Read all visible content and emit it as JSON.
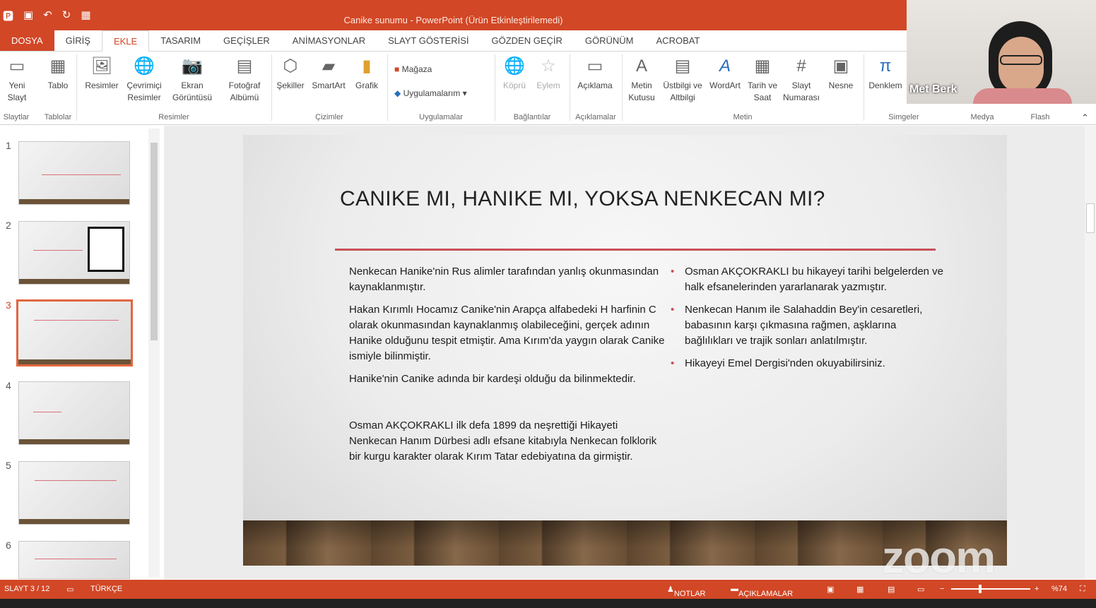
{
  "window": {
    "title": "Canike sunumu  -  PowerPoint (Ürün Etkinleştirilemedi)"
  },
  "tabs": [
    "DOSYA",
    "GİRİŞ",
    "EKLE",
    "TASARIM",
    "GEÇİŞLER",
    "ANİMASYONLAR",
    "SLAYT GÖSTERİSİ",
    "GÖZDEN GEÇİR",
    "GÖRÜNÜM",
    "ACROBAT"
  ],
  "ribbon": {
    "yeni_slayt": "Yeni Slayt",
    "tablo": "Tablo",
    "resimler": "Resimler",
    "cevrimici_resimler": "Çevrimiçi Resimler",
    "ekran_goruntusu": "Ekran Görüntüsü",
    "fotograf_albumu": "Fotoğraf Albümü",
    "sekiller": "Şekiller",
    "smartart": "SmartArt",
    "grafik": "Grafik",
    "magaza": "Mağaza",
    "uygulamalarim": "Uygulamalarım",
    "kopru": "Köprü",
    "eylem": "Eylem",
    "aciklama": "Açıklama",
    "metin_kutusu": "Metin Kutusu",
    "ustbilgi": "Üstbilgi ve Altbilgi",
    "wordart": "WordArt",
    "tarih_saat": "Tarih ve Saat",
    "slayt_numarasi": "Slayt Numarası",
    "nesne": "Nesne",
    "denklem": "Denklem",
    "groups": {
      "slaytlar": "Slaytlar",
      "tablolar": "Tablolar",
      "resimler": "Resimler",
      "cizimler": "Çizimler",
      "uygulamalar": "Uygulamalar",
      "baglantilar": "Bağlantılar",
      "aciklamalar": "Açıklamalar",
      "metin": "Metin",
      "simgeler": "Simgeler",
      "medya": "Medya",
      "flash": "Flash"
    }
  },
  "thumbnails": [
    "1",
    "2",
    "3",
    "4",
    "5",
    "6"
  ],
  "slide": {
    "title": "CANIKE MI, HANIKE MI, YOKSA NENKECAN MI?",
    "left": [
      "Nenkecan Hanike'nin Rus alimler tarafından yanlış okunmasından kaynaklanmıştır.",
      "Hakan Kırımlı Hocamız Canike'nin  Arapça alfabedeki H harfinin C olarak okunmasından kaynaklanmış olabileceğini, gerçek adının Hanike olduğunu tespit etmiştir. Ama Kırım'da yaygın olarak Canike  ismiyle bilinmiştir.",
      "Hanike'nin Canike adında bir kardeşi olduğu da bilinmektedir.",
      "Osman AKÇOKRAKLI ilk defa 1899 da neşrettiği Hikayeti Nenkecan Hanım Dürbesi   adlı efsane kitabıyla Nenkecan folklorik bir kurgu karakter olarak Kırım Tatar edebiyatına da girmiştir."
    ],
    "right": [
      "Osman AKÇOKRAKLI bu hikayeyi tarihi belgelerden ve halk efsanelerinden yararlanarak yazmıştır.",
      "Nenkecan Hanım ile Salahaddin Bey'in cesaretleri, babasının karşı çıkmasına rağmen, aşklarına bağlılıkları ve trajik sonları anlatılmıştır.",
      "Hikayeyi Emel Dergisi'nden okuyabilirsiniz."
    ]
  },
  "status": {
    "slide": "SLAYT 3 / 12",
    "language": "TÜRKÇE",
    "notes": "NOTLAR",
    "comments": "AÇIKLAMALAR",
    "zoom": "%74"
  },
  "webcam": {
    "name": "Met Berk"
  },
  "overlay": {
    "zoom_logo": "zoom"
  },
  "colors": {
    "accent": "#d24726",
    "title_line": "#c8505a"
  }
}
